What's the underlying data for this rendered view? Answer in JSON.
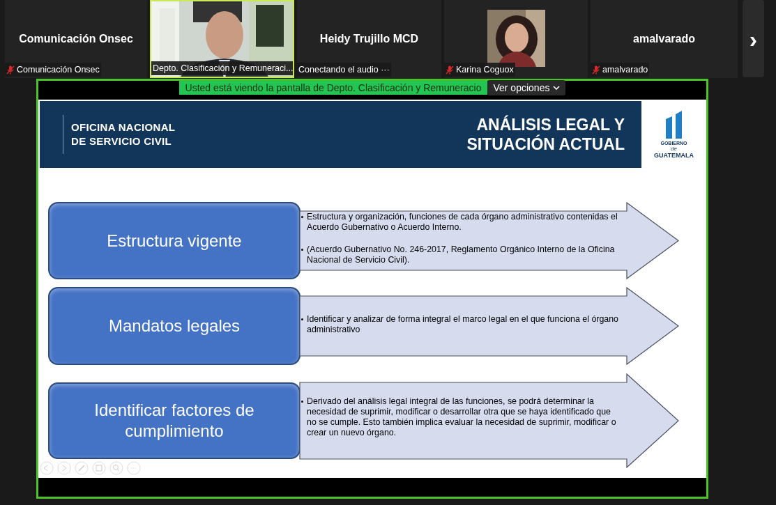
{
  "participants": [
    {
      "kind": "name",
      "display_name": "Comunicación Onsec",
      "label": "Comunicación Onsec",
      "muted": true,
      "speaking": false
    },
    {
      "kind": "video",
      "label": "Depto. Clasificación y Remuneraci...",
      "muted": false,
      "speaking": true
    },
    {
      "kind": "name",
      "display_name": "Heidy Trujillo MCD",
      "label": "Conectando el audio ···",
      "muted": false,
      "speaking": false
    },
    {
      "label": "Karina Coguox",
      "muted": true,
      "speaking": false
    },
    {
      "kind": "name",
      "display_name": "amalvarado",
      "label": "amalvarado",
      "muted": true,
      "speaking": false
    }
  ],
  "next_page_button": "›",
  "share_banner": {
    "text": "Usted está viendo la pantalla de Depto. Clasificación y Remuneracio",
    "button": "Ver opciones"
  },
  "slide": {
    "org_name": "OFICINA NACIONAL\nDE SERVICIO CIVIL",
    "title": "ANÁLISIS LEGAL Y\nSITUACIÓN ACTUAL",
    "logo": {
      "top": "GOBIERNO",
      "small": "de",
      "bottom": "GUATEMALA"
    },
    "rows": [
      {
        "label": "Estructura vigente",
        "bullets": [
          "Estructura y organización, funciones de cada órgano administrativo contenidas el Acuerdo Gubernativo o Acuerdo Interno.",
          "(Acuerdo Gubernativo No. 246-2017, Reglamento Orgánico Interno de la Oficina Nacional de Servicio Civil)."
        ]
      },
      {
        "label": "Mandatos legales",
        "bullets": [
          "Identificar y analizar de forma integral el marco legal en el que funciona el órgano administrativo"
        ]
      },
      {
        "label": "Identificar factores de cumplimiento",
        "bullets": [
          "Derivado del análisis legal integral de las funciones, se podrá determinar la necesidad de suprimir, modificar o desarrollar otra que se haya identificado que no se cumple. Esto también implica evaluar la necesidad de suprimir, modificar o crear un nuevo órgano."
        ]
      }
    ]
  }
}
